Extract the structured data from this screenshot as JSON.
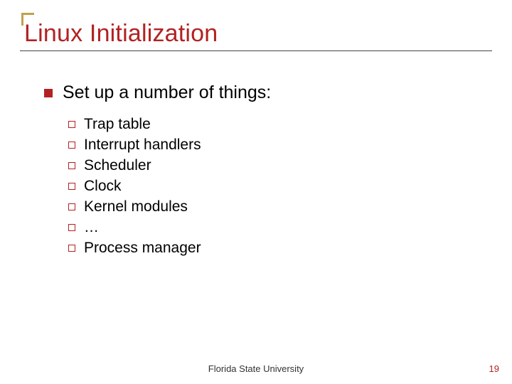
{
  "title": "Linux Initialization",
  "heading": "Set up a number of things:",
  "items": [
    "Trap table",
    "Interrupt handlers",
    "Scheduler",
    "Clock",
    "Kernel modules",
    "…",
    "Process manager"
  ],
  "footer_center": "Florida State University",
  "page_number": "19"
}
